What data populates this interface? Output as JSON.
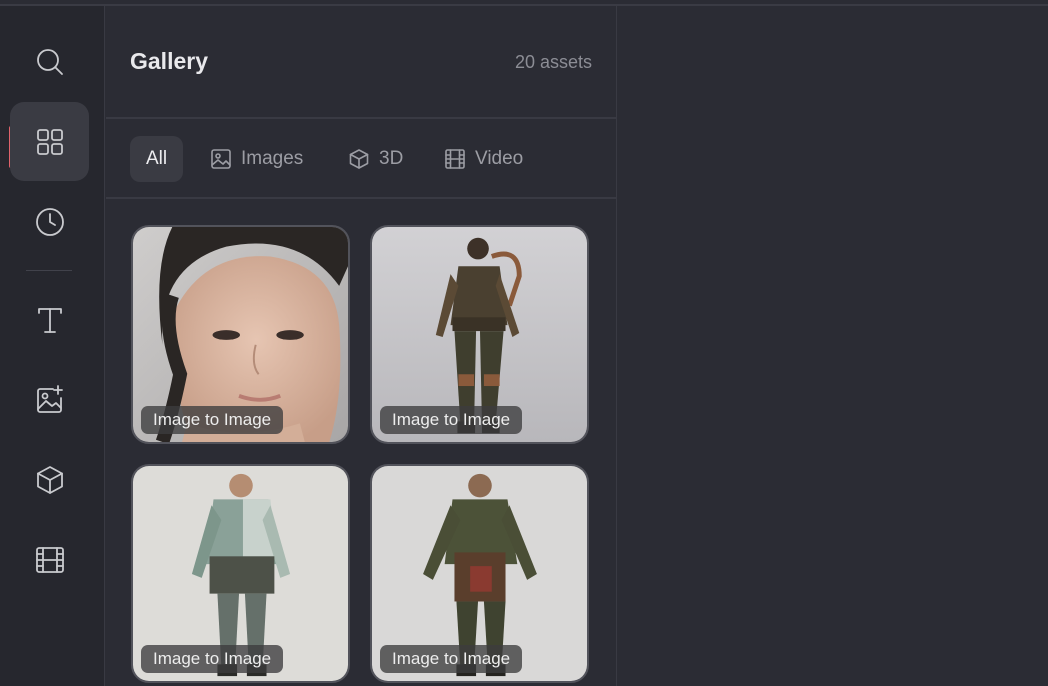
{
  "rail": {
    "items": [
      {
        "name": "search",
        "icon": "search-icon"
      },
      {
        "name": "gallery",
        "icon": "grid-icon",
        "active": true
      },
      {
        "name": "history",
        "icon": "clock-icon"
      },
      {
        "name": "text",
        "icon": "text-icon"
      },
      {
        "name": "image-add",
        "icon": "image-plus-icon"
      },
      {
        "name": "3d",
        "icon": "cube-icon"
      },
      {
        "name": "video",
        "icon": "film-icon"
      }
    ],
    "accent_color": "#e0636b"
  },
  "panel": {
    "title": "Gallery",
    "count": "20 assets",
    "tabs": [
      {
        "label": "All",
        "icon": "",
        "active": true
      },
      {
        "label": "Images",
        "icon": "image-icon"
      },
      {
        "label": "3D",
        "icon": "cube-icon"
      },
      {
        "label": "Video",
        "icon": "film-icon"
      }
    ]
  },
  "gallery": {
    "items": [
      {
        "badge": "Image to Image",
        "subject": "woman-portrait"
      },
      {
        "badge": "Image to Image",
        "subject": "armored-character"
      },
      {
        "badge": "Image to Image",
        "subject": "worker-character-light"
      },
      {
        "badge": "Image to Image",
        "subject": "worker-character-dark"
      }
    ]
  }
}
